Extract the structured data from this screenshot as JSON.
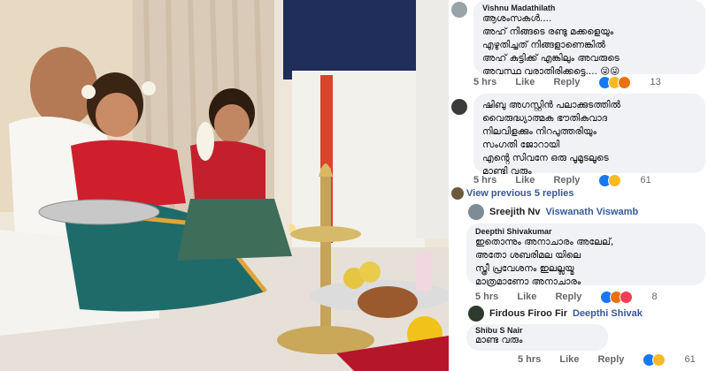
{
  "comments": [
    {
      "author": "Vishnu Madathilath",
      "text": "ആശംസകൾ....\nഅഹ് നിങ്ങടെ രണ്ടു മക്കളെയും\nഎഴുതിച്ചത് നിങ്ങളാണെങ്കിൽ\nഅഹ് കുട്ടിക്ക് എങ്കിലും അവരുടെ\nഅവസ്ഥ വരാതിരിക്കട്ടെ.... 😜😜",
      "time": "5 hrs",
      "like": "Like",
      "reply": "Reply",
      "count": "13"
    },
    {
      "author": "",
      "text": "ഷിബു അഗസ്റ്റിൻ പലാക്കുടത്തിൽ\nവൈരുദ്ധ്യാത്മക ഭൗതികവാദ\nനിലവിളക്കും നിറപുത്തരിയും\nസംഗതി ജോറായി\nഎൻ്റെ സിവനേ ഒരു പൂമൂടലൂടെ\nമാണ്ടി വരും",
      "time": "5 hrs",
      "like": "Like",
      "reply": "Reply",
      "count": "61"
    },
    {
      "author": "Deepthi Shivakumar",
      "text": "ഇതൊന്നും അനാചാരം അലേല്,\nഅതോ ശബരിമല യിലെ\nസ്ത്രീ പ്രവേശനം ഇലല്ലയ്മ\nമാത്രമാണോ അനാചാരം",
      "time": "5 hrs",
      "like": "Like",
      "reply": "Reply",
      "count": "8"
    },
    {
      "author": "Shibu S Nair",
      "text": "മാണ്ട വരും",
      "time": "5 hrs",
      "like": "Like",
      "reply": "Reply",
      "count": "61"
    }
  ],
  "view_previous": "View previous 5 replies",
  "reply_sreejith": {
    "name": "Sreejith Nv",
    "tag": "Viswanath Viswamb"
  },
  "reply_firdous": {
    "name": "Firdous Firoo Fir",
    "tag": "Deepthi Shivak"
  },
  "colors": {
    "bubble": "#f0f2f5",
    "link": "#385898",
    "like": "#1877f2",
    "haha": "#f7b928"
  },
  "icons": [
    "avatar",
    "like-reaction-icon",
    "haha-reaction-icon",
    "angry-reaction-icon",
    "love-reaction-icon"
  ]
}
